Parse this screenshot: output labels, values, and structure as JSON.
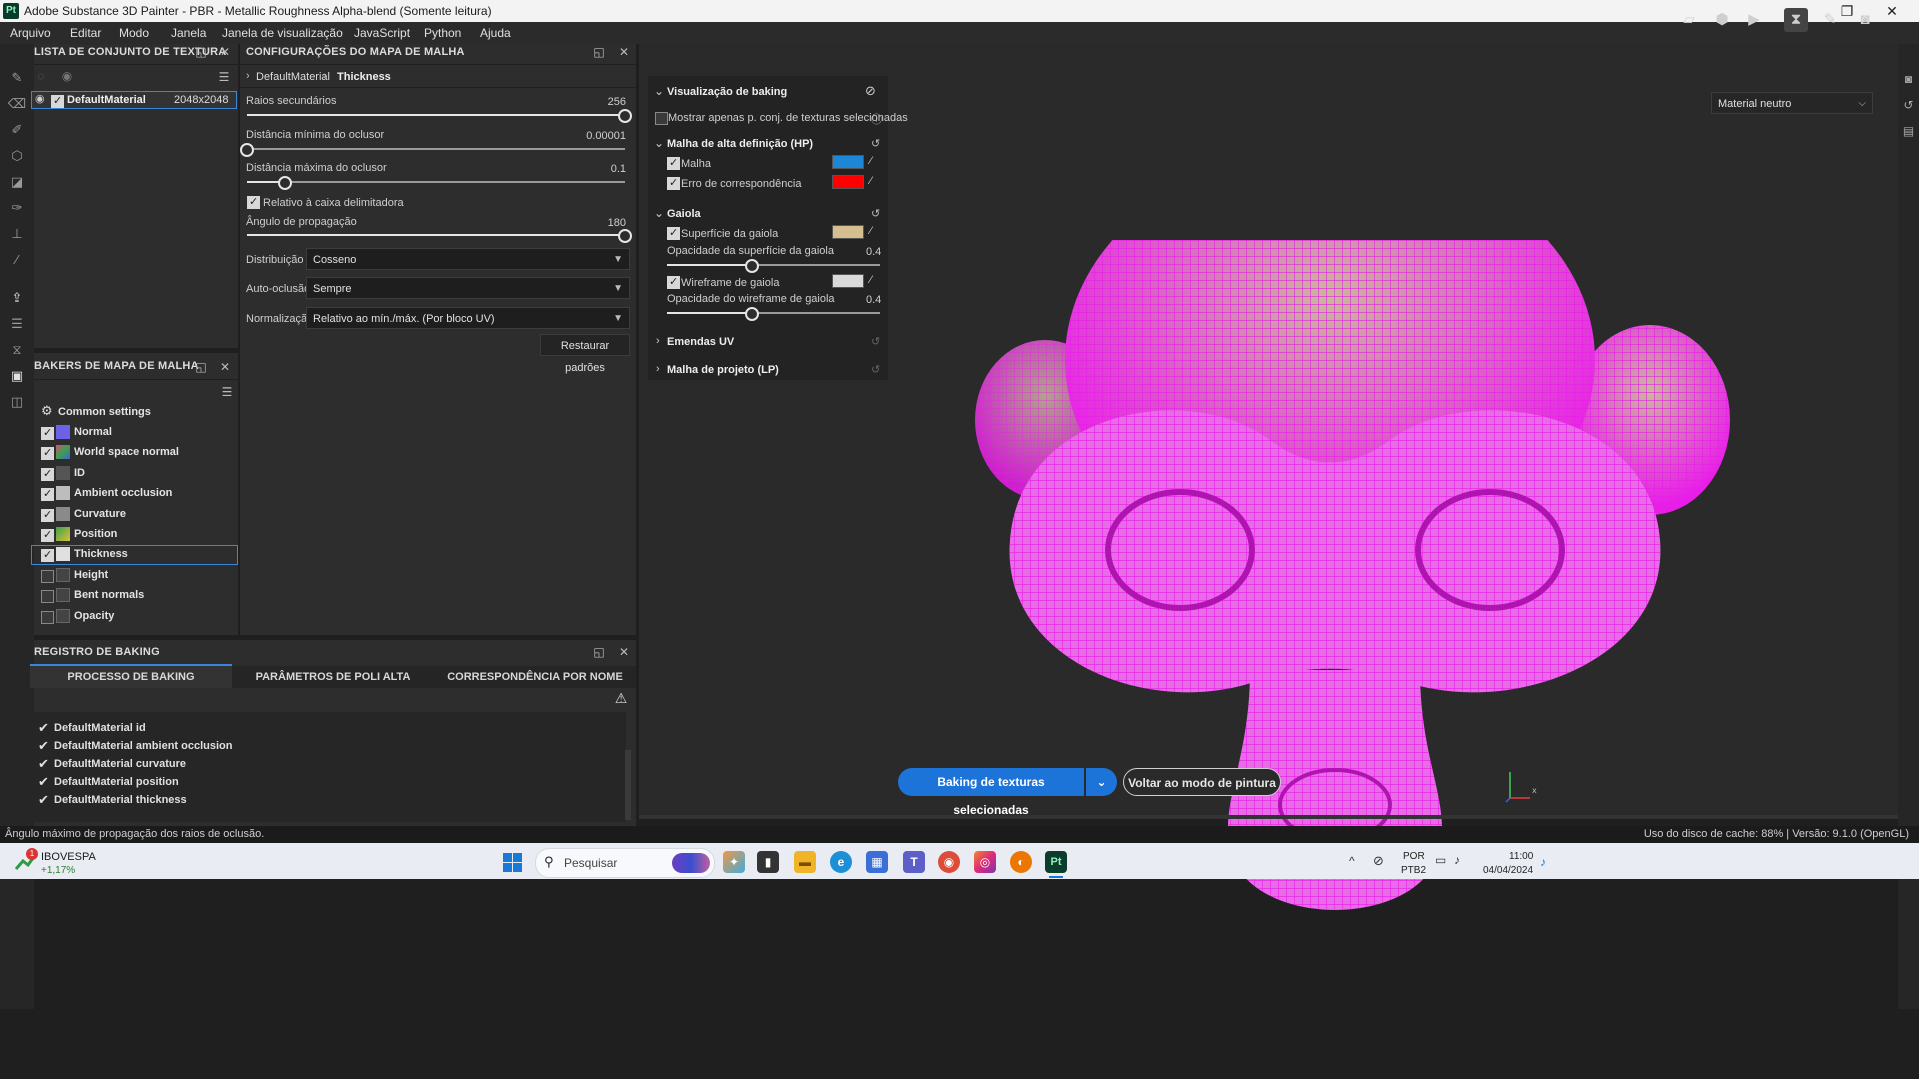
{
  "window": {
    "title": "Adobe Substance 3D Painter - PBR - Metallic Roughness Alpha-blend (Somente leitura)",
    "logo": "Pt",
    "controls": {
      "minimize": "─",
      "maximize": "❐",
      "close": "✕"
    }
  },
  "menu": [
    "Arquivo",
    "Editar",
    "Modo",
    "Janela",
    "Janela de visualização",
    "JavaScript",
    "Python",
    "Ajuda"
  ],
  "texture_set_panel": {
    "title": "LISTA DE CONJUNTO DE TEXTURA",
    "item": {
      "name": "DefaultMaterial",
      "size": "2048x2048"
    }
  },
  "mesh_map_settings": {
    "title": "CONFIGURAÇÕES DO MAPA DE MALHA",
    "breadcrumb": {
      "root": "DefaultMaterial",
      "current": "Thickness"
    },
    "sliders": [
      {
        "label": "Raios secundários",
        "value": "256",
        "fraction": 1.0
      },
      {
        "label": "Distância mínima do oclusor",
        "value": "0.00001",
        "fraction": 0.0
      },
      {
        "label": "Distância máxima do oclusor",
        "value": "0.1",
        "fraction": 0.1
      },
      {
        "label": "Ângulo de propagação",
        "value": "180",
        "fraction": 1.0
      }
    ],
    "relative_checkbox": "Relativo à caixa delimitadora",
    "dropdowns": [
      {
        "label": "Distribuição",
        "value": "Cosseno"
      },
      {
        "label": "Auto-oclusão",
        "value": "Sempre"
      },
      {
        "label": "Normalização",
        "value": "Relativo ao mín./máx. (Por bloco UV)"
      }
    ],
    "restore_button": "Restaurar padrões"
  },
  "bakers_panel": {
    "title": "BAKERS DE MAPA DE MALHA",
    "common_settings": "Common settings",
    "items": [
      {
        "name": "Normal",
        "checked": true,
        "color": "#6b62e6"
      },
      {
        "name": "World space normal",
        "checked": true,
        "color": "#d05080"
      },
      {
        "name": "ID",
        "checked": true,
        "color": "#555555"
      },
      {
        "name": "Ambient occlusion",
        "checked": true,
        "color": "#bdbdbd"
      },
      {
        "name": "Curvature",
        "checked": true,
        "color": "#8a8a8a"
      },
      {
        "name": "Position",
        "checked": true,
        "color": "#3fa04a"
      },
      {
        "name": "Thickness",
        "checked": true,
        "color": "#e0e0e0"
      },
      {
        "name": "Height",
        "checked": false,
        "color": "#444444"
      },
      {
        "name": "Bent normals",
        "checked": false,
        "color": "#444444"
      },
      {
        "name": "Opacity",
        "checked": false,
        "color": "#444444"
      }
    ]
  },
  "baking_log": {
    "title": "REGISTRO DE BAKING",
    "tabs": [
      "PROCESSO DE BAKING",
      "PARÂMETROS DE POLI ALTA",
      "CORRESPONDÊNCIA POR NOME"
    ],
    "entries": [
      "DefaultMaterial id",
      "DefaultMaterial ambient occlusion",
      "DefaultMaterial curvature",
      "DefaultMaterial position",
      "DefaultMaterial thickness"
    ]
  },
  "viewport": {
    "material_dropdown": "Material neutro",
    "baking_view": {
      "title": "Visualização de baking",
      "show_selected": "Mostrar apenas p. conj. de texturas selecionadas",
      "hp_section": "Malha de alta definição (HP)",
      "hp_mesh": {
        "label": "Malha",
        "color": "#1b87d6"
      },
      "hp_error": {
        "label": "Erro de correspondência",
        "color": "#ff0000"
      },
      "cage_section": "Gaiola",
      "cage_surface": {
        "label": "Superfície da gaiola",
        "color": "#d6bf8f"
      },
      "cage_surface_opacity": {
        "label": "Opacidade da superfície da gaiola",
        "value": "0.4",
        "fraction": 0.4
      },
      "cage_wireframe": {
        "label": "Wireframe de gaiola",
        "color": "#d9d9d9"
      },
      "cage_wireframe_opacity": {
        "label": "Opacidade do wireframe de gaiola",
        "value": "0.4",
        "fraction": 0.4
      },
      "uv_seams": "Emendas UV",
      "lp_section": "Malha de projeto (LP)"
    },
    "bake_button": "Baking de texturas selecionadas",
    "return_button": "Voltar ao modo de pintura",
    "wire_color": "#e81ee8",
    "surface_color": "#c9b89a"
  },
  "statusbar": {
    "hint": "Ângulo máximo de propagação dos raios de oclusão.",
    "cache": "Uso do disco de cache:  88% | Versão: 9.1.0 (OpenGL)"
  },
  "taskbar": {
    "stock": {
      "name": "IBOVESPA",
      "change": "+1,17%",
      "badge": "1"
    },
    "search": "Pesquisar",
    "lang": "POR",
    "layout": "PTB2",
    "time": "11:00",
    "date": "04/04/2024"
  }
}
